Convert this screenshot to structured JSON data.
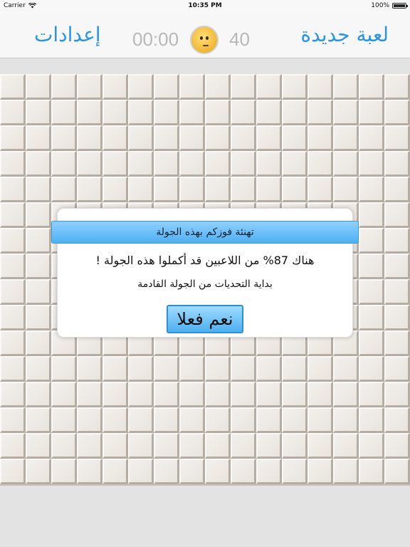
{
  "status_bar": {
    "carrier": "Carrier",
    "time": "10:35 PM",
    "battery": "100%"
  },
  "nav": {
    "settings_label": "إعدادات",
    "new_game_label": "لعبة جديدة",
    "timer": "00:00",
    "mine_count": "40"
  },
  "board": {
    "rows": 16,
    "cols": 16
  },
  "dialog": {
    "title": "تهنئة فوزكم بهذه الجولة",
    "message_line1": "هناك 87% من اللاعبين قد أكملوا هذه الجولة !",
    "message_line2": "بداية التحديات من الجولة القادمة",
    "button_label": "نعم فعلا"
  },
  "colors": {
    "accent": "#2a94e8",
    "counter_gray": "#b8b8b8",
    "dialog_blue": "#4fb0f2"
  },
  "icons": {
    "wifi": "wifi-icon",
    "battery": "battery-icon",
    "face": "smiley-neutral-icon"
  }
}
